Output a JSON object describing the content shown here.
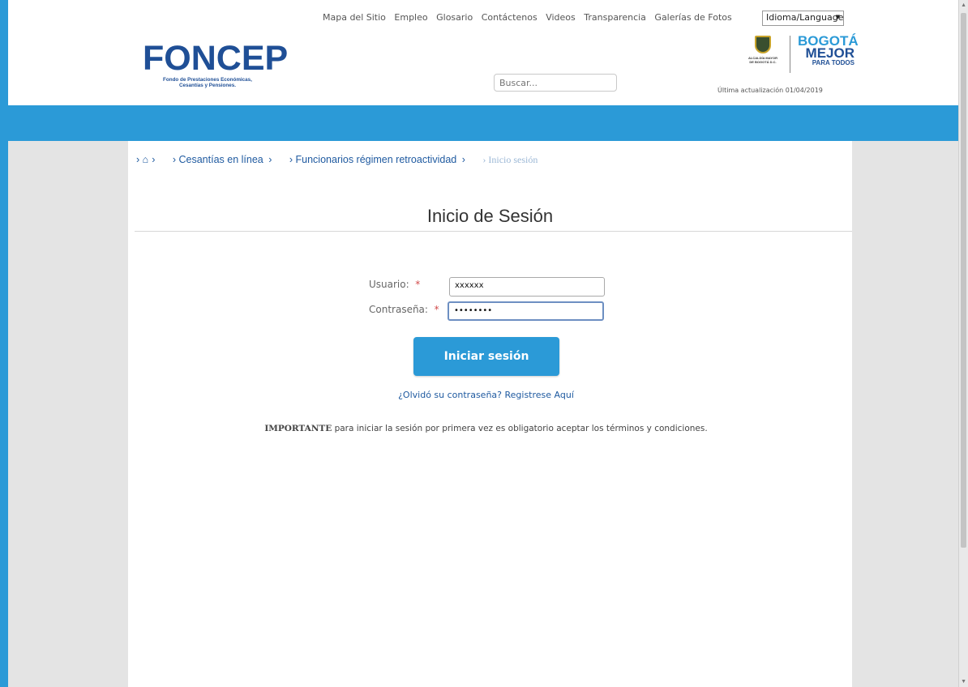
{
  "top_nav": {
    "links": [
      "Mapa del Sitio",
      "Empleo",
      "Glosario",
      "Contáctenos",
      "Videos",
      "Transparencia",
      "Galerías de Fotos"
    ],
    "language_select": "Idioma/Language"
  },
  "logo": {
    "name": "FONCEP",
    "subtitle_line1": "Fondo de Prestaciones Económicas,",
    "subtitle_line2": "Cesantías y Pensiones."
  },
  "search": {
    "placeholder": "Buscar..."
  },
  "partner_logo": {
    "seal_line1": "ALCALDÍA MAYOR",
    "seal_line2": "DE BOGOTÁ D.C.",
    "line1": "BOGOTÁ",
    "line2": "MEJOR",
    "line3": "PARA TODOS"
  },
  "last_update": "Última actualización 01/04/2019",
  "breadcrumb": {
    "home_icon": "home-icon",
    "items": [
      "Cesantías en línea",
      "Funcionarios régimen retroactividad"
    ],
    "current": "Inicio sesión"
  },
  "login": {
    "title": "Inicio de Sesión",
    "user_label": "Usuario:",
    "user_value": "xxxxxx",
    "password_label": "Contraseña:",
    "password_value": "••••••••",
    "required_mark": "*",
    "submit_label": "Iniciar sesión",
    "forgot_link": "¿Olvidó su contraseña? Registrese Aquí",
    "important_bold": "IMPORTANTE",
    "important_text": " para iniciar la sesión por primera vez es obligatorio aceptar los términos y condiciones."
  },
  "colors": {
    "brand_blue": "#2b9ad7",
    "logo_navy": "#1f4f96"
  }
}
